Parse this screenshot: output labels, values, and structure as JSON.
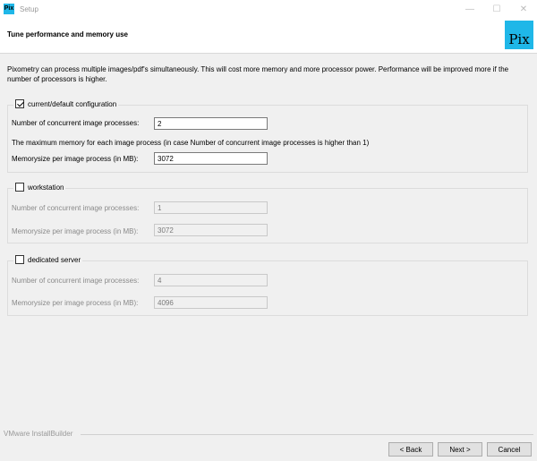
{
  "window": {
    "title": "Setup",
    "app_icon_text": "Pix",
    "minimize_glyph": "—",
    "maximize_glyph": "☐",
    "close_glyph": "✕"
  },
  "header": {
    "title": "Tune performance and memory use",
    "logo_text": "Pix",
    "logo_color": "#1fb7e8"
  },
  "intro_text": "Pixometry can process multiple images/pdf's simultaneously. This will cost more memory and more processor power. Performance will be improved more if the number of processors is higher.",
  "groups": [
    {
      "label": "current/default configuration",
      "checked": true,
      "processes_label": "Number of concurrent image processes:",
      "processes_value": "2",
      "note": "The maximum memory for each image process (in case Number of concurrent image processes is higher than 1)",
      "memory_label": "Memorysize per image process (in MB):",
      "memory_value": "3072"
    },
    {
      "label": "workstation",
      "checked": false,
      "processes_label": "Number of concurrent image processes:",
      "processes_value": "1",
      "memory_label": "Memorysize per image process (in MB):",
      "memory_value": "3072"
    },
    {
      "label": "dedicated server",
      "checked": false,
      "processes_label": "Number of concurrent image processes:",
      "processes_value": "4",
      "memory_label": "Memorysize per image process (in MB):",
      "memory_value": "4096"
    }
  ],
  "footer": {
    "brand": "VMware InstallBuilder",
    "back_label": "< Back",
    "next_label": "Next >",
    "cancel_label": "Cancel"
  }
}
